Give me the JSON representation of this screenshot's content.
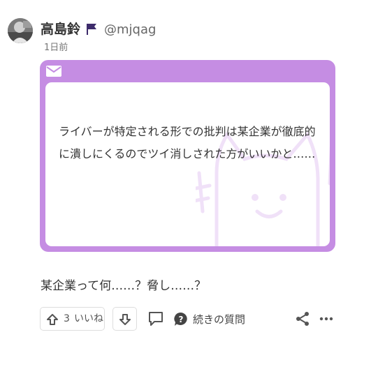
{
  "user": {
    "name": "高島鈴",
    "handle": "@mjqag",
    "post_time": "1日前"
  },
  "question": {
    "text": "ライバーが特定される形での批判は某企業が徹底的に潰しにくるのでツイ消しされた方がいいかと……"
  },
  "answer": {
    "text": "某企業って何……？脅し……？"
  },
  "actions": {
    "like_count": "3",
    "like_label": "いいね",
    "followup_label": "続きの質問"
  },
  "colors": {
    "card": "#c58de3",
    "watermark": "#f0e1f8",
    "flag": "#3d2b6b"
  },
  "icons": {
    "avatar": "avatar-photo",
    "flag": "flag-icon",
    "mail": "mail-icon",
    "like": "arrow-up-icon",
    "dislike": "arrow-down-icon",
    "comment": "comment-icon",
    "followup": "question-bubble-icon",
    "share": "share-icon",
    "more": "more-dots-icon"
  }
}
